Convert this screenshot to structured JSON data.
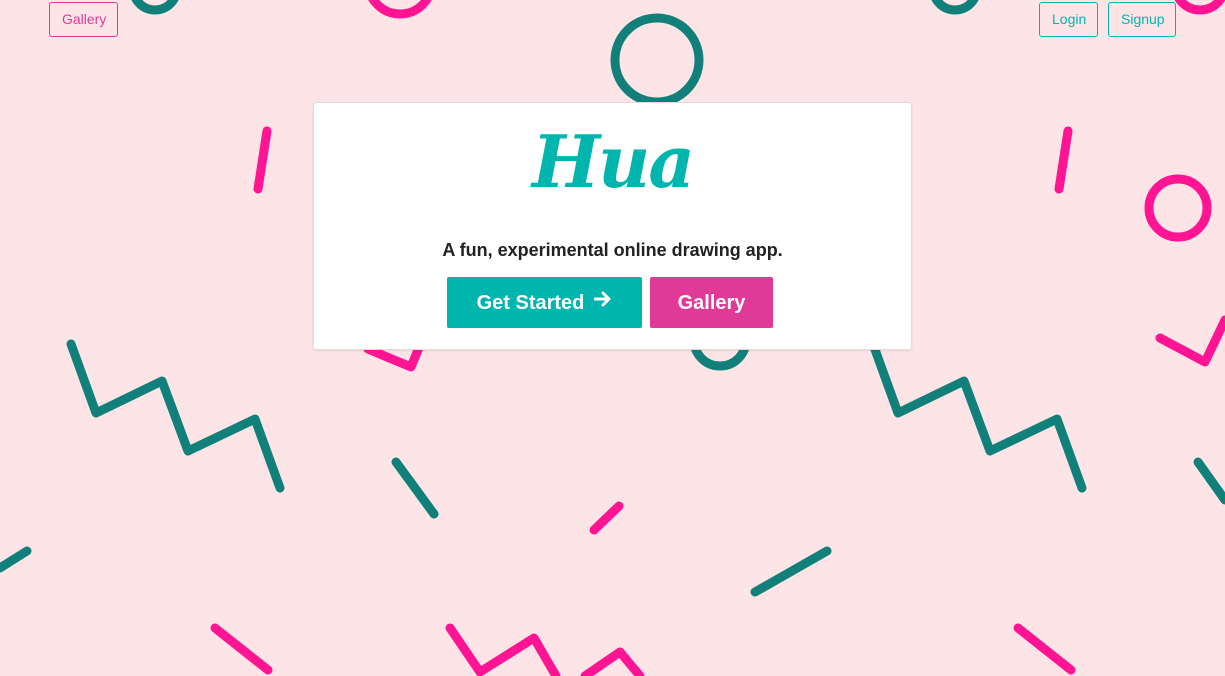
{
  "nav": {
    "gallery_label": "Gallery",
    "login_label": "Login",
    "signup_label": "Signup"
  },
  "hero": {
    "logo_text": "Hua",
    "tagline": "A fun, experimental online drawing app.",
    "get_started_label": "Get Started",
    "get_started_icon": "arrow-right-icon",
    "gallery_label": "Gallery"
  },
  "colors": {
    "background": "#fde5e7",
    "teal": "#00b5ad",
    "dark_teal": "#12807a",
    "pink": "#e03997",
    "hot_pink": "#ff1493",
    "card_bg": "#ffffff",
    "text": "#222222"
  },
  "decorations": {
    "shapes": [
      "ring",
      "stroke",
      "zigzag"
    ]
  }
}
